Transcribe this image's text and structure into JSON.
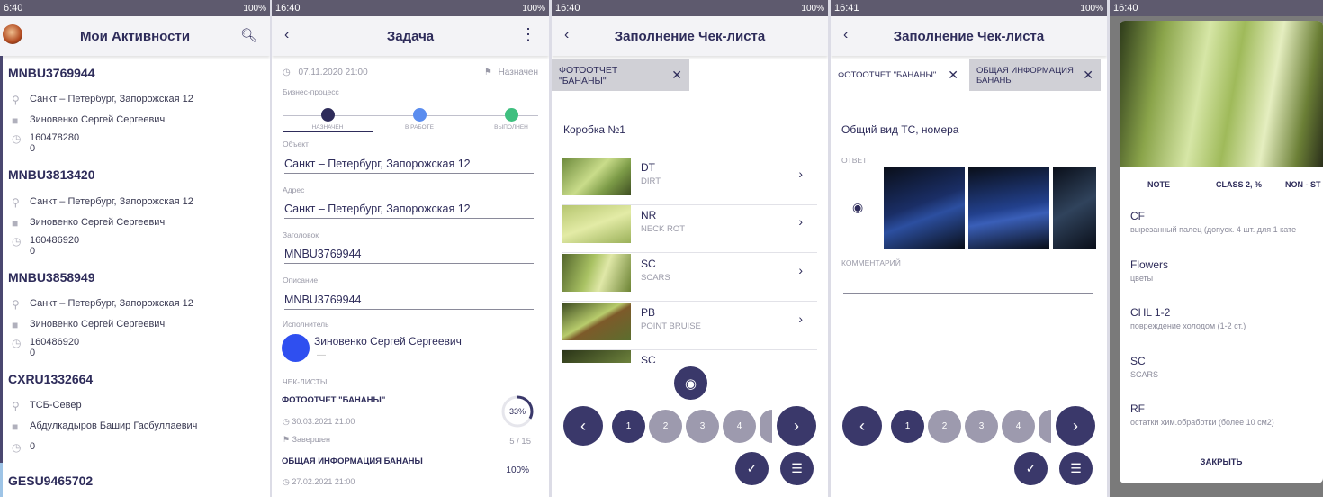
{
  "status": {
    "s1": {
      "time": "6:40",
      "right": "100%"
    },
    "s2": {
      "time": "16:40",
      "right": "100%"
    },
    "s3": {
      "time": "16:40",
      "right": "100%"
    },
    "s4": {
      "time": "16:41",
      "right": "100%"
    },
    "s5": {
      "time": "16:40"
    }
  },
  "s1": {
    "title": "Мои Активности",
    "items": [
      {
        "code": "MNBU3769944",
        "address": "Санкт – Петербург, Запорожская 12",
        "person": "Зиновенко Сергей Сергеевич",
        "num": "160478280",
        "sub": "0"
      },
      {
        "code": "MNBU3813420",
        "address": "Санкт – Петербург, Запорожская 12",
        "person": "Зиновенко Сергей Сергеевич",
        "num": "160486920",
        "sub": "0"
      },
      {
        "code": "MNBU3858949",
        "address": "Санкт – Петербург, Запорожская 12",
        "person": "Зиновенко Сергей Сергеевич",
        "num": "160486920",
        "sub": "0"
      },
      {
        "code": "CXRU1332664",
        "address": "ТСБ-Север",
        "person": "Абдулкадыров Башир Гасбуллаевич",
        "num": "0",
        "sub": ""
      },
      {
        "code": "GESU9465702"
      }
    ]
  },
  "s2": {
    "title": "Задача",
    "date": "07.11.2020 21:00",
    "status": "Назначен",
    "process_label": "Бизнес-процесс",
    "steps": [
      "НАЗНАЧЕН",
      "В РАБОТЕ",
      "ВЫПОЛНЕН"
    ],
    "object_label": "Объект",
    "object": "Санкт – Петербург, Запорожская 12",
    "address_label": "Адрес",
    "address": "Санкт – Петербург, Запорожская 12",
    "heading_label": "Заголовок",
    "heading": "MNBU3769944",
    "desc_label": "Описание",
    "desc": "MNBU3769944",
    "assignee_label": "Исполнитель",
    "assignee": "Зиновенко Сергей Сергеевич",
    "assignee_sub": "—",
    "checklists_label": "ЧЕК-ЛИСТЫ",
    "checklists": [
      {
        "name": "ФОТООТЧЕТ \"БАНАНЫ\"",
        "date": "30.03.2021 21:00",
        "status": "Завершен",
        "percent": "33%",
        "count": "5 / 15",
        "progress": 0.33
      },
      {
        "name": "ОБЩАЯ ИНФОРМАЦИЯ БАНАНЫ",
        "date": "27.02.2021 21:00",
        "percent": "100%"
      }
    ]
  },
  "s3": {
    "title": "Заполнение Чек-листа",
    "tab": "ФОТООТЧЕТ \"БАНАНЫ\"",
    "section": "Коробка №1",
    "rows": [
      {
        "code": "DT",
        "desc": "DIRT"
      },
      {
        "code": "NR",
        "desc": "NECK ROT"
      },
      {
        "code": "SC",
        "desc": "SCARS"
      },
      {
        "code": "PB",
        "desc": "POINT BRUISE"
      },
      {
        "code": "SC",
        "desc": ""
      }
    ],
    "pages": [
      "1",
      "2",
      "3",
      "4"
    ]
  },
  "s4": {
    "title": "Заполнение Чек-листа",
    "tab1": "ФОТООТЧЕТ \"БАНАНЫ\"",
    "tab2": "ОБЩАЯ ИНФОРМАЦИЯ БАНАНЫ",
    "section": "Общий вид ТС, номера",
    "answer_label": "ОТВЕТ",
    "comment_label": "КОММЕНТАРИЙ",
    "pages": [
      "1",
      "2",
      "3",
      "4"
    ]
  },
  "s5": {
    "headers": [
      "NOTE",
      "CLASS 2, %",
      "NON - ST"
    ],
    "items": [
      {
        "code": "CF",
        "desc": "вырезанный палец (допуск. 4 шт. для 1 кате"
      },
      {
        "code": "Flowers",
        "desc": "цветы"
      },
      {
        "code": "CHL 1-2",
        "desc": "повреждение холодом (1-2 ст.)"
      },
      {
        "code": "SC",
        "desc": "SCARS"
      },
      {
        "code": "RF",
        "desc": "остатки хим.обработки (более 10 см2)"
      }
    ],
    "close": "ЗАКРЫТЬ"
  },
  "colors": {
    "primary": "#3a386a",
    "accent": "#2e2c5a",
    "step_done": "#2e2c5a",
    "step_work": "#5b8def",
    "step_end": "#3fbf7f"
  }
}
